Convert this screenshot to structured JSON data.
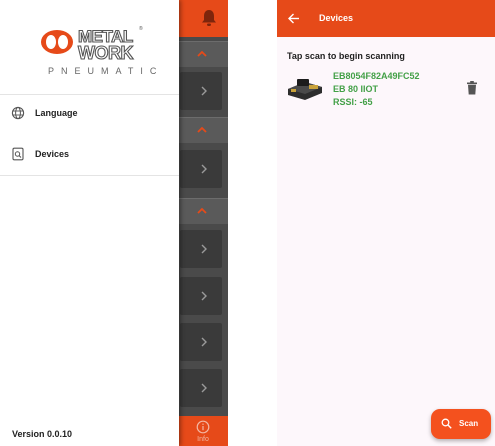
{
  "drawer": {
    "logo_text": "METAL WORK",
    "logo_tagline": "PNEUMATIC",
    "items": [
      {
        "label": "Language",
        "icon": "globe-icon"
      },
      {
        "label": "Devices",
        "icon": "device-search-icon"
      }
    ],
    "version": "Version 0.0.10"
  },
  "background_app": {
    "bottom_tab_label": "Info"
  },
  "devices_screen": {
    "title": "Devices",
    "hint": "Tap scan to begin scanning",
    "devices": [
      {
        "id": "EB8054F82A49FC52",
        "model": "EB 80 IIOT",
        "rssi": "RSSI: -65"
      }
    ],
    "scan_button": "Scan"
  },
  "colors": {
    "accent": "#e64a19",
    "fab": "#f4511e",
    "device_text": "#43a047",
    "drawer_bg": "#ffffff",
    "scrim": "#4a4a4a"
  }
}
